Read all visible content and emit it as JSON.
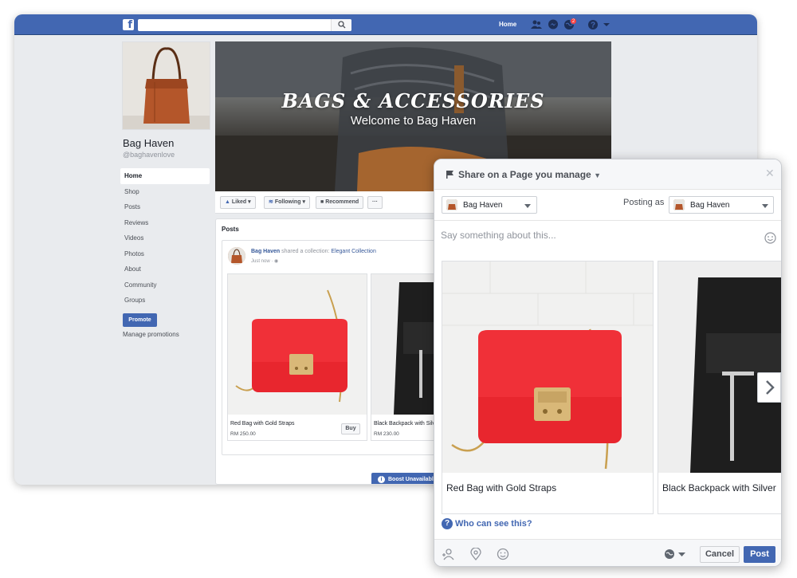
{
  "topbar": {
    "home_label": "Home",
    "notification_count": "2"
  },
  "page": {
    "name": "Bag Haven",
    "handle": "@baghavenlove",
    "nav": [
      {
        "label": "Home"
      },
      {
        "label": "Shop"
      },
      {
        "label": "Posts"
      },
      {
        "label": "Reviews"
      },
      {
        "label": "Videos"
      },
      {
        "label": "Photos"
      },
      {
        "label": "About"
      },
      {
        "label": "Community"
      },
      {
        "label": "Groups"
      }
    ],
    "promote_label": "Promote",
    "manage_promotions_label": "Manage promotions"
  },
  "cover": {
    "headline": "BAGS & ACCESSORIES",
    "subtitle": "Welcome to Bag Haven"
  },
  "action_bar": {
    "liked": "Liked",
    "following": "Following",
    "recommend": "Recommend",
    "more": "···"
  },
  "posts": {
    "title": "Posts",
    "author": "Bag Haven",
    "shared_text": "shared a collection:",
    "collection": "Elegant Collection",
    "time": "Just now ·",
    "products": [
      {
        "name": "Red Bag with Gold Straps",
        "price": "RM 250.00",
        "buy": "Buy"
      },
      {
        "name": "Black Backpack with Silver",
        "price": "RM 230.00"
      }
    ],
    "boost_label": "Boost Unavailable"
  },
  "dialog": {
    "title": "Share on a Page you manage",
    "page_select": "Bag Haven",
    "posting_as_label": "Posting as",
    "posting_as_value": "Bag Haven",
    "placeholder": "Say something about this...",
    "products": [
      {
        "name": "Red Bag with Gold Straps"
      },
      {
        "name": "Black Backpack with Silver"
      }
    ],
    "who_can_see": "Who can see this?",
    "cancel_label": "Cancel",
    "post_label": "Post"
  },
  "colors": {
    "facebook_blue": "#4267b2",
    "link_blue": "#365899",
    "background_gray": "#e9ebee",
    "bag_red": "#e8262e",
    "bag_black": "#1e1e1e"
  }
}
